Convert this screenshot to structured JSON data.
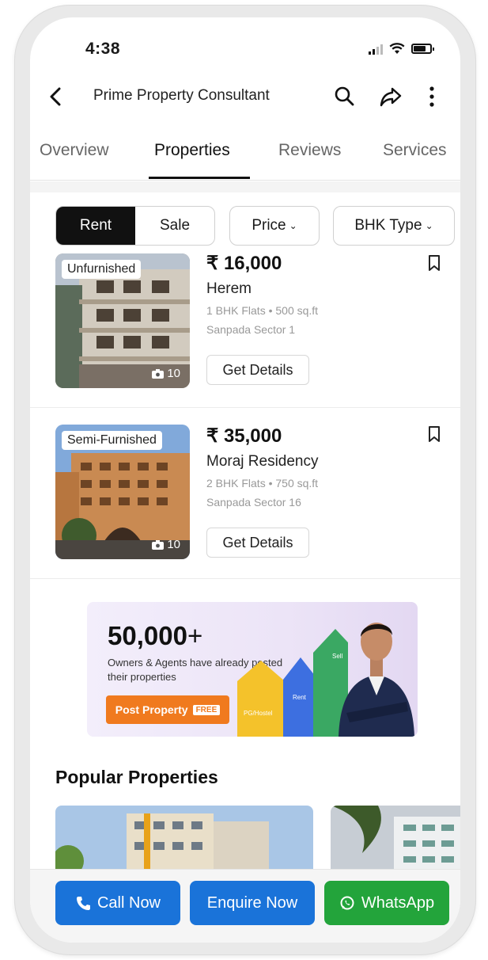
{
  "status_bar": {
    "time": "4:38",
    "battery_level": 0.7
  },
  "app_bar": {
    "title": "Prime Property Consultant"
  },
  "tabs": [
    {
      "label": "Overview",
      "active": false
    },
    {
      "label": "Properties",
      "active": true
    },
    {
      "label": "Reviews",
      "active": false
    },
    {
      "label": "Services",
      "active": false
    }
  ],
  "filters": {
    "segment": {
      "rent": "Rent",
      "sale": "Sale",
      "selected": "Rent"
    },
    "price": "Price",
    "bhk_type": "BHK Type"
  },
  "listings": [
    {
      "badge": "Unfurnished",
      "photo_count": "10",
      "price": "₹ 16,000",
      "name": "Herem",
      "details": "1 BHK Flats • 500 sq.ft",
      "location": "Sanpada Sector 1",
      "cta": "Get Details"
    },
    {
      "badge": "Semi-Furnished",
      "photo_count": "10",
      "price": "₹ 35,000",
      "name": "Moraj Residency",
      "details": "2 BHK Flats • 750 sq.ft",
      "location": "Sanpada Sector 16",
      "cta": "Get Details"
    }
  ],
  "banner": {
    "count": "50,000",
    "plus": "+",
    "subtitle": "Owners & Agents have already posted their properties",
    "button": "Post Property",
    "free_tag": "FREE",
    "house_labels": [
      "PG/Hostel",
      "Rent",
      "Sell"
    ]
  },
  "popular": {
    "title": "Popular Properties"
  },
  "actions": {
    "call": "Call Now",
    "enquire": "Enquire Now",
    "whatsapp": "WhatsApp"
  },
  "colors": {
    "call": "#1a73d9",
    "enquire": "#1a73d9",
    "whatsapp": "#23a43b",
    "post_property": "#f07a1e"
  }
}
